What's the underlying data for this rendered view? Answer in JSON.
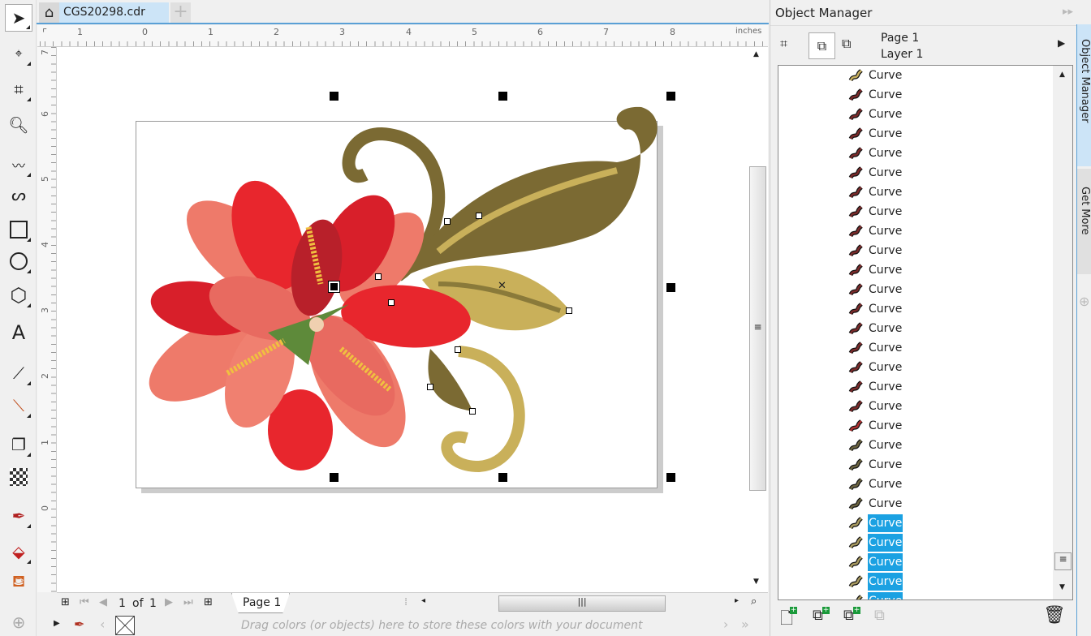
{
  "document_tab": {
    "title": "CGS20298.cdr",
    "home_icon": "home-icon",
    "add_icon": "plus-icon"
  },
  "toolbox": [
    "pick-tool",
    "shape-tool",
    "crop-tool",
    "zoom-tool",
    "freehand-tool",
    "artistic-media-tool",
    "rectangle-tool",
    "ellipse-tool",
    "polygon-tool",
    "text-tool",
    "parallel-dimension-tool",
    "connector-tool",
    "drop-shadow-tool",
    "transparency-tool",
    "eyedropper-tool",
    "interactive-fill-tool",
    "smart-fill-tool"
  ],
  "ruler": {
    "unit": "inches",
    "h_labels": [
      "1",
      "0",
      "1",
      "2",
      "3",
      "4",
      "5",
      "6",
      "7",
      "8"
    ],
    "v_labels": [
      "7",
      "6",
      "5",
      "4",
      "3",
      "2",
      "1",
      "0"
    ]
  },
  "page_nav": {
    "current": "1",
    "of": "of",
    "total": "1",
    "page_tab": "Page 1"
  },
  "palette": {
    "hint": "Drag colors (or objects) here to store these colors with your document"
  },
  "object_manager": {
    "title": "Object Manager",
    "page": "Page 1",
    "layer": "Layer 1",
    "items": [
      {
        "label": "Curve",
        "color": "#c8b060",
        "selected": false
      },
      {
        "label": "Curve",
        "color": "#7a2a2a",
        "selected": false
      },
      {
        "label": "Curve",
        "color": "#7a2a2a",
        "selected": false
      },
      {
        "label": "Curve",
        "color": "#7a2a2a",
        "selected": false
      },
      {
        "label": "Curve",
        "color": "#7a2a2a",
        "selected": false
      },
      {
        "label": "Curve",
        "color": "#7a2a2a",
        "selected": false
      },
      {
        "label": "Curve",
        "color": "#7a2a2a",
        "selected": false
      },
      {
        "label": "Curve",
        "color": "#7a2a2a",
        "selected": false
      },
      {
        "label": "Curve",
        "color": "#7a2a2a",
        "selected": false
      },
      {
        "label": "Curve",
        "color": "#7a2a2a",
        "selected": false
      },
      {
        "label": "Curve",
        "color": "#7a2a2a",
        "selected": false
      },
      {
        "label": "Curve",
        "color": "#7a2a2a",
        "selected": false
      },
      {
        "label": "Curve",
        "color": "#7a2a2a",
        "selected": false
      },
      {
        "label": "Curve",
        "color": "#7a2a2a",
        "selected": false
      },
      {
        "label": "Curve",
        "color": "#7a2a2a",
        "selected": false
      },
      {
        "label": "Curve",
        "color": "#7a2a2a",
        "selected": false
      },
      {
        "label": "Curve",
        "color": "#7a2a2a",
        "selected": false
      },
      {
        "label": "Curve",
        "color": "#7a2a2a",
        "selected": false
      },
      {
        "label": "Curve",
        "color": "#b03030",
        "selected": false
      },
      {
        "label": "Curve",
        "color": "#6b6340",
        "selected": false
      },
      {
        "label": "Curve",
        "color": "#6b6340",
        "selected": false
      },
      {
        "label": "Curve",
        "color": "#6b6340",
        "selected": false
      },
      {
        "label": "Curve",
        "color": "#6b6340",
        "selected": false
      },
      {
        "label": "Curve",
        "color": "#a89a60",
        "selected": true
      },
      {
        "label": "Curve",
        "color": "#a89a60",
        "selected": true
      },
      {
        "label": "Curve",
        "color": "#a89a60",
        "selected": true
      },
      {
        "label": "Curve",
        "color": "#a89a60",
        "selected": true
      },
      {
        "label": "Curve",
        "color": "#a89a60",
        "selected": true
      },
      {
        "label": "Curve",
        "color": "#a89a60",
        "selected": true
      }
    ]
  },
  "docker_tabs": [
    "Object Manager",
    "Get More"
  ],
  "colors": {
    "selection": "#1ba1e2",
    "tab_active": "#cce4f7",
    "accent": "#5aa0d6"
  }
}
